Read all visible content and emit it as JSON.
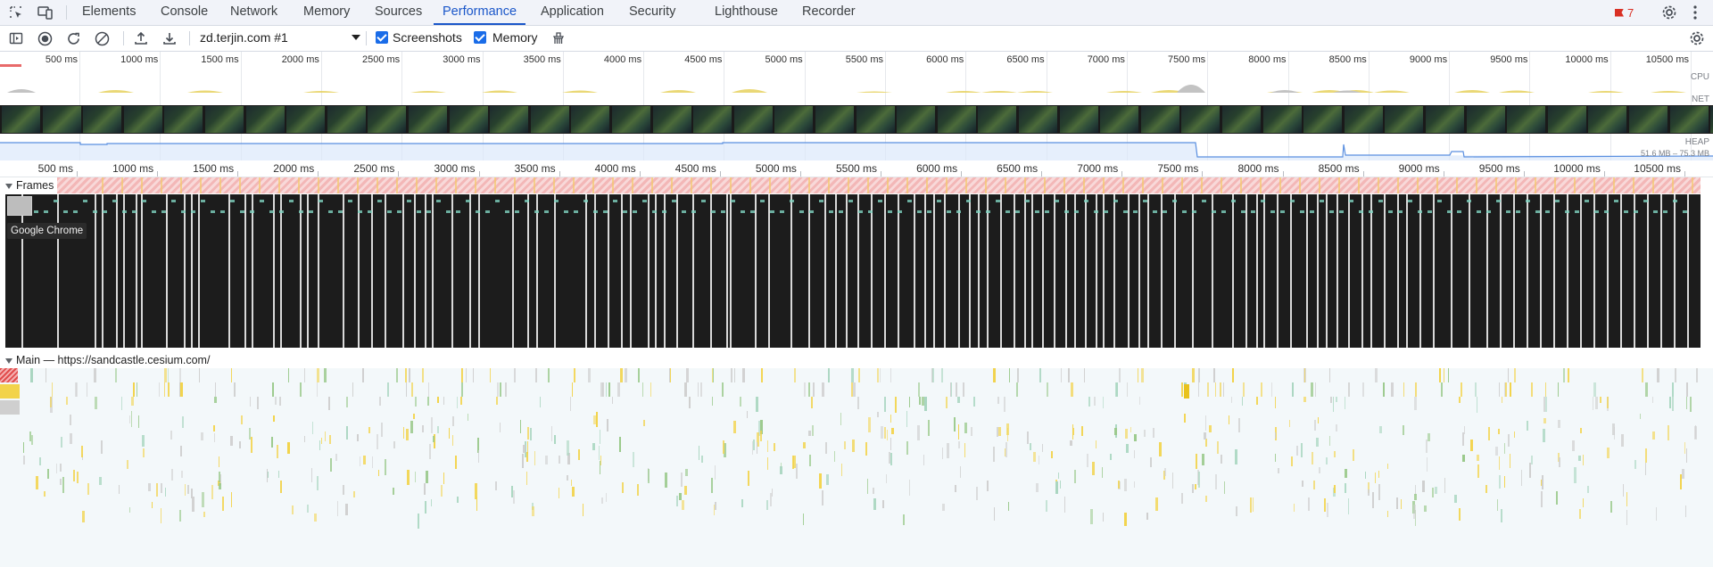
{
  "tabs": {
    "items": [
      "Elements",
      "Console",
      "Network",
      "Memory",
      "Sources",
      "Performance",
      "Application",
      "Security",
      "Lighthouse",
      "Recorder"
    ],
    "active": "Performance",
    "issues_count": "7"
  },
  "toolbar": {
    "target": "zd.terjin.com #1",
    "screenshots_label": "Screenshots",
    "memory_label": "Memory"
  },
  "overview": {
    "ticks": [
      "500 ms",
      "1000 ms",
      "1500 ms",
      "2000 ms",
      "2500 ms",
      "3000 ms",
      "3500 ms",
      "4000 ms",
      "4500 ms",
      "5000 ms",
      "5500 ms",
      "6000 ms",
      "6500 ms",
      "7000 ms",
      "7500 ms",
      "8000 ms",
      "8500 ms",
      "9000 ms",
      "9500 ms",
      "10000 ms",
      "10500 ms"
    ],
    "cpu_label": "CPU",
    "net_label": "NET",
    "heap_label": "HEAP",
    "heap_range": "51.6 MB – 75.3 MB"
  },
  "ruler": {
    "ticks": [
      "500 ms",
      "1000 ms",
      "1500 ms",
      "2000 ms",
      "2500 ms",
      "3000 ms",
      "3500 ms",
      "4000 ms",
      "4500 ms",
      "5000 ms",
      "5500 ms",
      "6000 ms",
      "6500 ms",
      "7000 ms",
      "7500 ms",
      "8000 ms",
      "8500 ms",
      "9000 ms",
      "9500 ms",
      "10000 ms",
      "10500 ms"
    ]
  },
  "frames": {
    "title": "Frames",
    "tooltip": "Google Chrome"
  },
  "main": {
    "title": "Main — https://sandcastle.cesium.com/"
  },
  "colors": {
    "accent": "#1a56c9",
    "frame_band": "#f3b7b7",
    "scripting": "#f2d34a",
    "rendering": "#9ac98b",
    "painting": "#a9d6c0"
  }
}
